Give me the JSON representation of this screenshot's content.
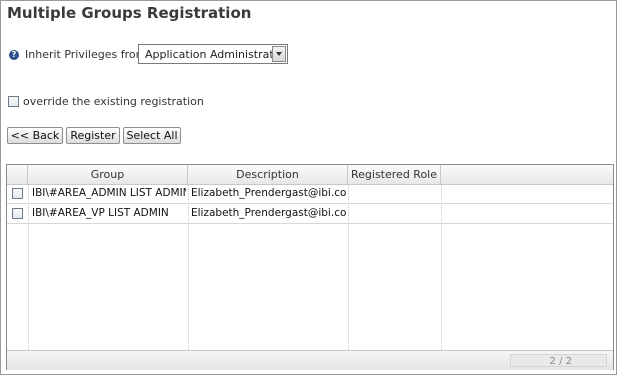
{
  "title": "Multiple Groups Registration",
  "inherit": {
    "label": "Inherit Privileges from",
    "selected": "Application Administrator",
    "help_icon": "question-circle-icon"
  },
  "override": {
    "label": "override the existing registration",
    "checked": false
  },
  "buttons": {
    "back": "<< Back",
    "register": "Register",
    "select_all": "Select All"
  },
  "table": {
    "columns": [
      "Group",
      "Description",
      "Registered Role"
    ],
    "rows": [
      {
        "group": "IBI\\#AREA_ADMIN LIST ADMIN",
        "description": "Elizabeth_Prendergast@ibi.com",
        "role": ""
      },
      {
        "group": "IBI\\#AREA_VP LIST ADMIN",
        "description": "Elizabeth_Prendergast@ibi.com",
        "role": ""
      }
    ],
    "pager": "2 / 2"
  },
  "colors": {
    "help_icon": "#2d4f8c",
    "border": "#9a9a9a"
  }
}
